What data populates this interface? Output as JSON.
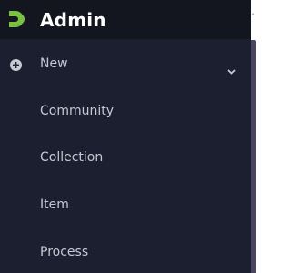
{
  "header": {
    "title": "Admin",
    "logo_icon": "dspace-logo-icon",
    "logo_color": "#7ac143"
  },
  "nav": {
    "items": [
      {
        "label": "New",
        "icon": "plus-circle-icon",
        "trailing_icon": "chevron-down-icon"
      },
      {
        "label": "Community"
      },
      {
        "label": "Collection"
      },
      {
        "label": "Item"
      },
      {
        "label": "Process"
      }
    ]
  },
  "colors": {
    "sidebar_bg": "#1c1f30",
    "header_bg": "#13151f",
    "text": "#c6c8d2",
    "title": "#ffffff"
  }
}
